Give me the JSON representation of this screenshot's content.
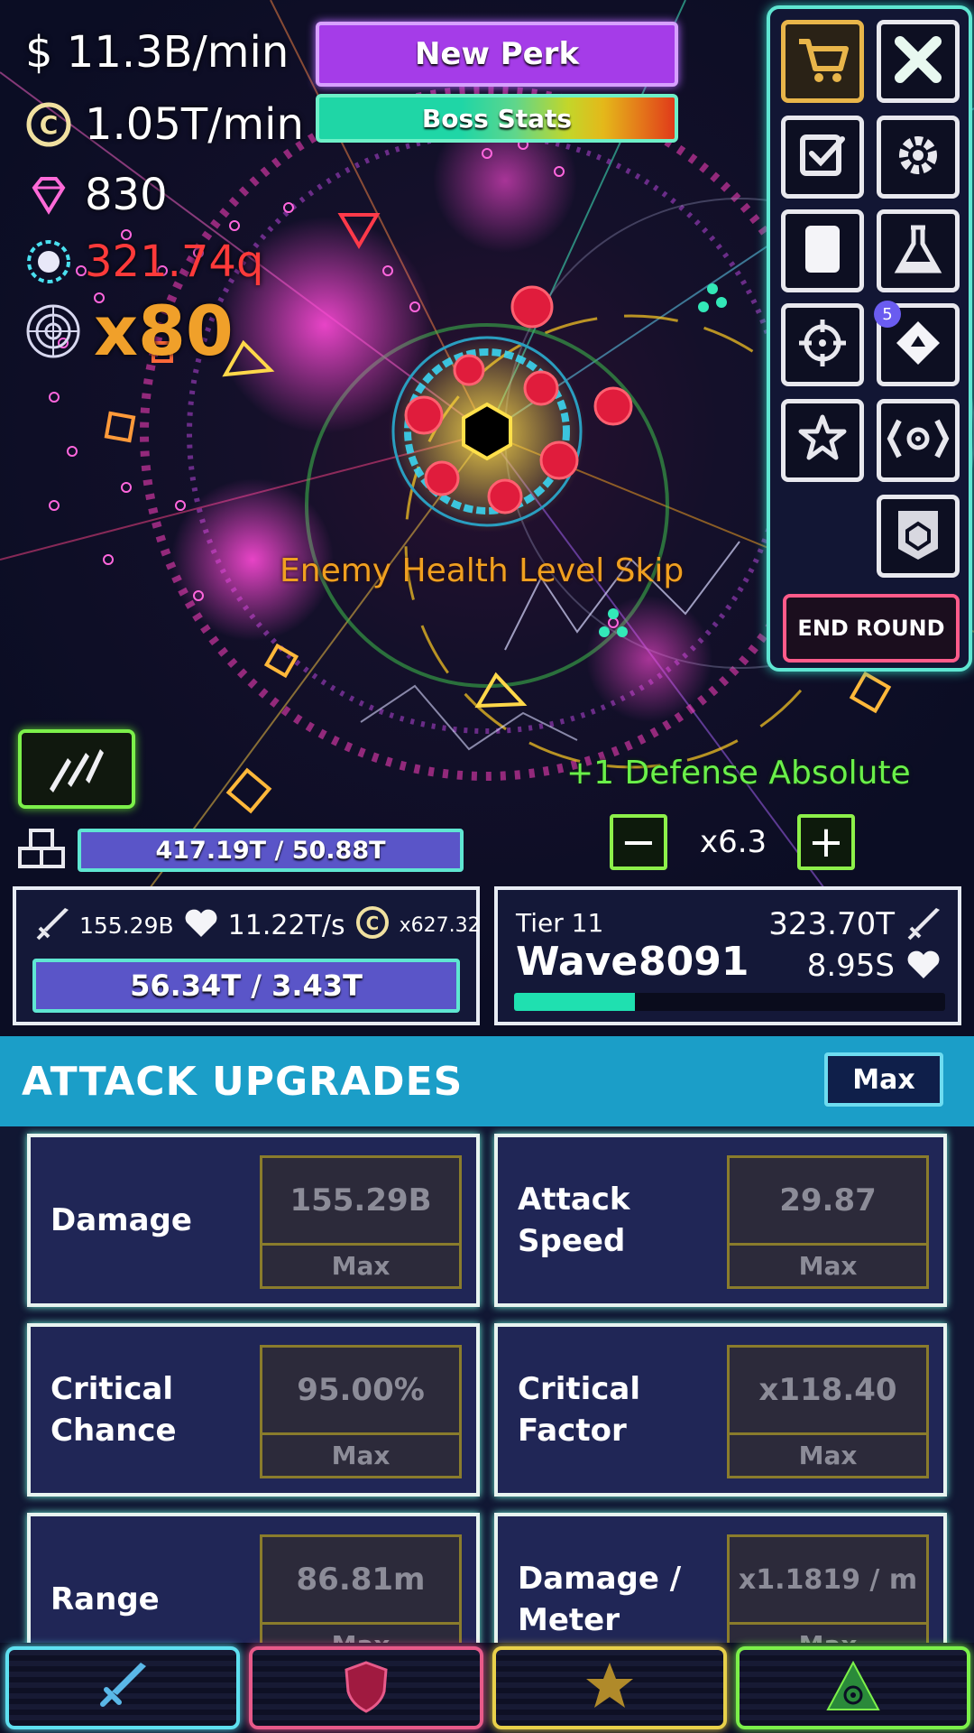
{
  "resources": {
    "cash_rate": "$ 11.3B/min",
    "coin_rate": "1.05T/min",
    "gems": "830",
    "power_value": "321.74q",
    "multiplier": "x80"
  },
  "top_buttons": {
    "new_perk": "New Perk",
    "boss_stats": "Boss Stats"
  },
  "menu": {
    "badge_count": "5",
    "end_round": "END ROUND",
    "icons": [
      "cart-icon",
      "close-icon",
      "checklist-icon",
      "gear-icon",
      "card-icon",
      "flask-icon",
      "crosshair-icon",
      "module-icon",
      "star-icon",
      "signal-icon",
      "banner-icon"
    ]
  },
  "battle_text": {
    "level_skip": "Enemy Health Level Skip",
    "defense_bonus": "+1 Defense Absolute"
  },
  "wall": {
    "health": "417.19T / 50.88T"
  },
  "speed": {
    "value": "x6.3",
    "minus": "−",
    "plus": "+"
  },
  "player": {
    "damage": "155.29B",
    "regen": "11.22T/s",
    "coin_mult": "x627.32",
    "health": "56.34T / 3.43T"
  },
  "wave": {
    "tier": "Tier 11",
    "label": "Wave",
    "number": "8091",
    "enemy_damage": "323.70T",
    "enemy_health": "8.95S",
    "progress": 0.28
  },
  "upgrades": {
    "title": "ATTACK UPGRADES",
    "max_label": "Max",
    "items": [
      {
        "name": "Damage",
        "value": "155.29B",
        "cost": "Max"
      },
      {
        "name": "Attack Speed",
        "value": "29.87",
        "cost": "Max"
      },
      {
        "name": "Critical Chance",
        "value": "95.00%",
        "cost": "Max"
      },
      {
        "name": "Critical Factor",
        "value": "x118.40",
        "cost": "Max"
      },
      {
        "name": "Range",
        "value": "86.81m",
        "cost": "Max"
      },
      {
        "name": "Damage / Meter",
        "value": "x1.1819 / m",
        "cost": "Max"
      }
    ]
  },
  "tabs": [
    {
      "name": "attack",
      "icon": "sword-icon",
      "color": "#5fe0f0"
    },
    {
      "name": "defense",
      "icon": "shield-icon",
      "color": "#e85a8a"
    },
    {
      "name": "utility",
      "icon": "star-icon",
      "color": "#e8d04a"
    },
    {
      "name": "ultimate",
      "icon": "eye-triangle-icon",
      "color": "#7cf04a"
    }
  ]
}
